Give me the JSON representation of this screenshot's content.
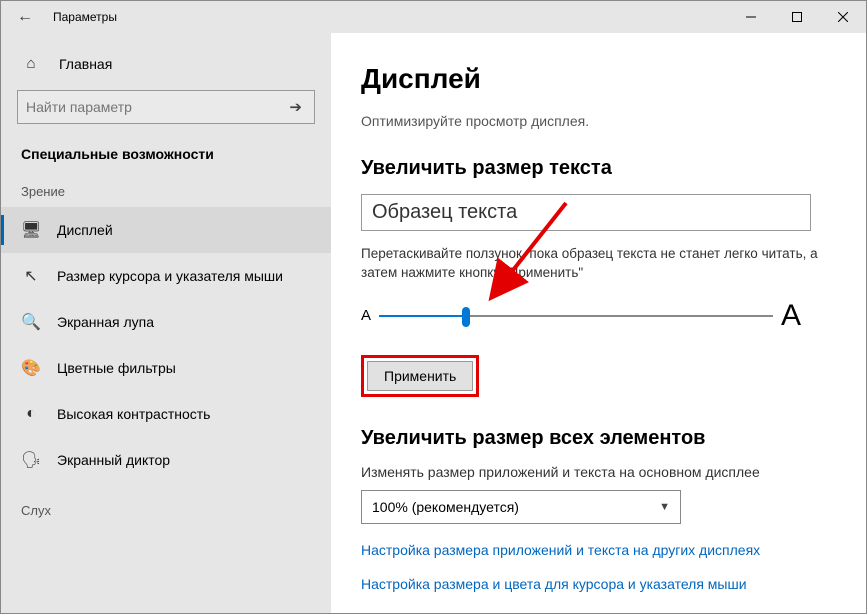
{
  "window": {
    "title": "Параметры"
  },
  "sidebar": {
    "home": "Главная",
    "search_placeholder": "Найти параметр",
    "section": "Специальные возможности",
    "category_vision": "Зрение",
    "items": [
      {
        "label": "Дисплей"
      },
      {
        "label": "Размер курсора и указателя мыши"
      },
      {
        "label": "Экранная лупа"
      },
      {
        "label": "Цветные фильтры"
      },
      {
        "label": "Высокая контрастность"
      },
      {
        "label": "Экранный диктор"
      }
    ],
    "category_hearing": "Слух"
  },
  "main": {
    "heading": "Дисплей",
    "subheading": "Оптимизируйте просмотр дисплея.",
    "text_size_hdr": "Увеличить размер текста",
    "sample_text": "Образец текста",
    "instruction": "Перетаскивайте ползунок, пока образец текста не станет легко читать, а затем нажмите кнопку \"Применить\"",
    "small_a": "A",
    "large_a": "A",
    "apply": "Применить",
    "all_elements_hdr": "Увеличить размер всех элементов",
    "scale_label": "Изменять размер приложений и текста на основном дисплее",
    "scale_value": "100% (рекомендуется)",
    "link1": "Настройка размера приложений и текста на других дисплеях",
    "link2": "Настройка размера и цвета для курсора и указателя мыши"
  }
}
